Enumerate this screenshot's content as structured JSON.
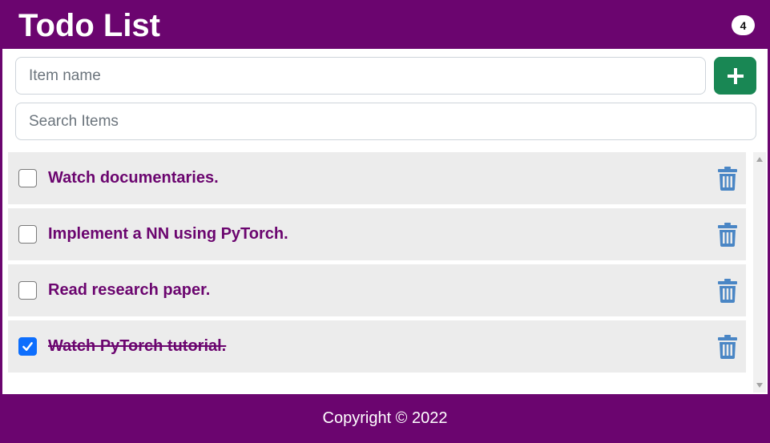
{
  "header": {
    "title": "Todo List",
    "count_badge": "4"
  },
  "form": {
    "item_placeholder": "Item name",
    "search_placeholder": "Search Items",
    "add_icon": "plus-icon"
  },
  "todos": [
    {
      "label": "Watch documentaries.",
      "done": false
    },
    {
      "label": "Implement a NN using PyTorch.",
      "done": false
    },
    {
      "label": "Read research paper.",
      "done": false
    },
    {
      "label": "Watch PyTorch tutorial.",
      "done": true
    }
  ],
  "footer": {
    "text": "Copyright © 2022"
  },
  "colors": {
    "brand": "#6b056f",
    "add_button": "#198754",
    "trash_icon": "#4a86c5",
    "checkbox_checked": "#0d6efd",
    "item_bg": "#ececec"
  }
}
